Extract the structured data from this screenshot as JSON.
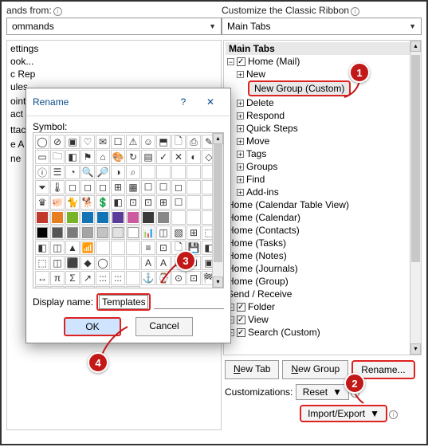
{
  "top": {
    "left_label": "ands from:",
    "left_value": "ommands",
    "right_label": "Customize the Classic Ribbon",
    "right_value": "Main Tabs"
  },
  "left_list": [
    "ettings",
    "ook...",
    "c Rep",
    "ules",
    "",
    "ointr",
    "act",
    "",
    "",
    "ttach",
    "",
    "e A",
    "",
    "ne"
  ],
  "tree": {
    "header": "Main Tabs",
    "home_mail": "Home (Mail)",
    "new": "New",
    "newgroup_custom": "New Group (Custom)",
    "items": [
      "Delete",
      "Respond",
      "Quick Steps",
      "Move",
      "Tags",
      "Groups",
      "Find",
      "Add-ins"
    ],
    "homes": [
      "Home (Calendar Table View)",
      "Home (Calendar)",
      "Home (Contacts)",
      "Home (Tasks)",
      "Home (Notes)",
      "Home (Journals)",
      "Home (Group)",
      "Send / Receive"
    ],
    "checked": [
      "Folder",
      "View",
      "Search (Custom)"
    ]
  },
  "buttons": {
    "newtab": "New Tab",
    "newgroup": "New Group",
    "rename": "Rename..."
  },
  "custom": {
    "label": "Customizations:",
    "reset": "Reset",
    "impexp": "Import/Export"
  },
  "dialog": {
    "title": "Rename",
    "symbol_label": "Symbol:",
    "display_label": "Display name:",
    "display_value": "Templates",
    "ok": "OK",
    "cancel": "Cancel",
    "swatches": [
      "#c0392b",
      "#e67e22",
      "#78b428",
      "#1273b5",
      "#1273b5",
      "#5a3d99",
      "#cc5a9e",
      "#3a3a3a",
      "#888888",
      "#000000",
      "#555555",
      "#7a7a7a",
      "#a5a5a5",
      "#c3c3c3",
      "#e1e1e1",
      "#ffffff"
    ]
  },
  "callouts": {
    "c1": "1",
    "c2": "2",
    "c3": "3",
    "c4": "4"
  }
}
